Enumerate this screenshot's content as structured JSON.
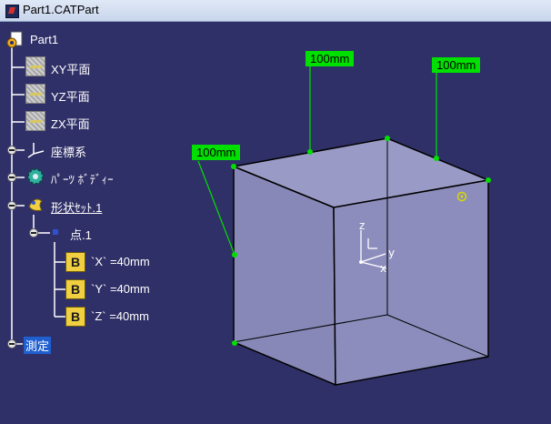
{
  "window": {
    "title": "Part1.CATPart"
  },
  "tree": {
    "root": "Part1",
    "planes": [
      "XY平面",
      "YZ平面",
      "ZX平面"
    ],
    "axis_system": "座標系",
    "part_body": "ﾊﾟｰﾂ ﾎﾞﾃﾞｨｰ",
    "geo_set": "形状ｾｯﾄ.1",
    "point": "点.1",
    "parameters": [
      "`X` =40mm",
      "`Y` =40mm",
      "`Z` =40mm"
    ],
    "measure": "測定"
  },
  "dimensions": [
    "100mm",
    "100mm",
    "100mm"
  ],
  "axis_labels": {
    "z": "z",
    "y": "y",
    "x": "x"
  },
  "colors": {
    "background": "#303068",
    "dimension_label": "#00e000",
    "cube_face": "#8d8dbd",
    "selection": "#1f5fcf"
  }
}
